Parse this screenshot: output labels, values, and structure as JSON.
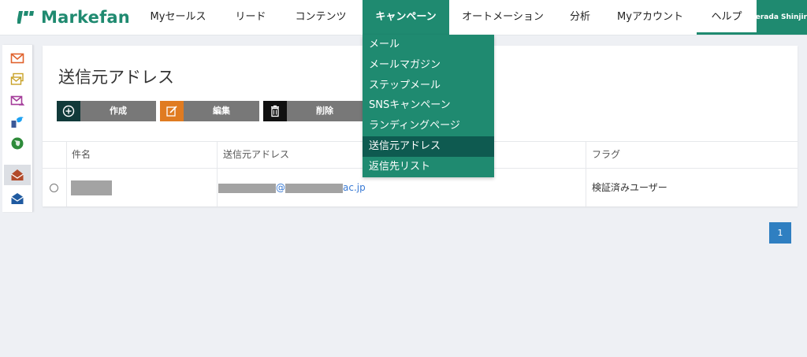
{
  "app": {
    "logo_text": "Markefan",
    "brand_color": "#1f8a70"
  },
  "nav": {
    "items": [
      {
        "label": "Myセールス"
      },
      {
        "label": "リード"
      },
      {
        "label": "コンテンツ"
      },
      {
        "label": "キャンペーン",
        "active": true
      },
      {
        "label": "オートメーション"
      },
      {
        "label": "分析"
      },
      {
        "label": "Myアカウント"
      },
      {
        "label": "ヘルプ"
      }
    ],
    "user_name": "Terada Shinjiro"
  },
  "sidebar": {
    "icons": [
      "mail-icon",
      "multi-mail-icon",
      "mail-forward-icon",
      "social-icon",
      "globe-icon",
      "sender-mail-icon",
      "reply-mail-icon"
    ],
    "selected_index": 5
  },
  "page": {
    "title": "送信元アドレス"
  },
  "toolbar": {
    "create_label": "作成",
    "edit_label": "編集",
    "delete_label": "削除"
  },
  "table": {
    "columns": [
      "件名",
      "送信元アドレス",
      "フラグ"
    ],
    "rows": [
      {
        "name": "",
        "email_at": "@",
        "email_suffix": "ac.jp",
        "flag": "検証済みユーザー"
      }
    ]
  },
  "dropdown": {
    "items": [
      "メール",
      "メールマガジン",
      "ステップメール",
      "SNSキャンペーン",
      "ランディングページ",
      "送信元アドレス",
      "返信先リスト"
    ],
    "active_index": 5
  },
  "pagination": {
    "current_page": "1"
  }
}
